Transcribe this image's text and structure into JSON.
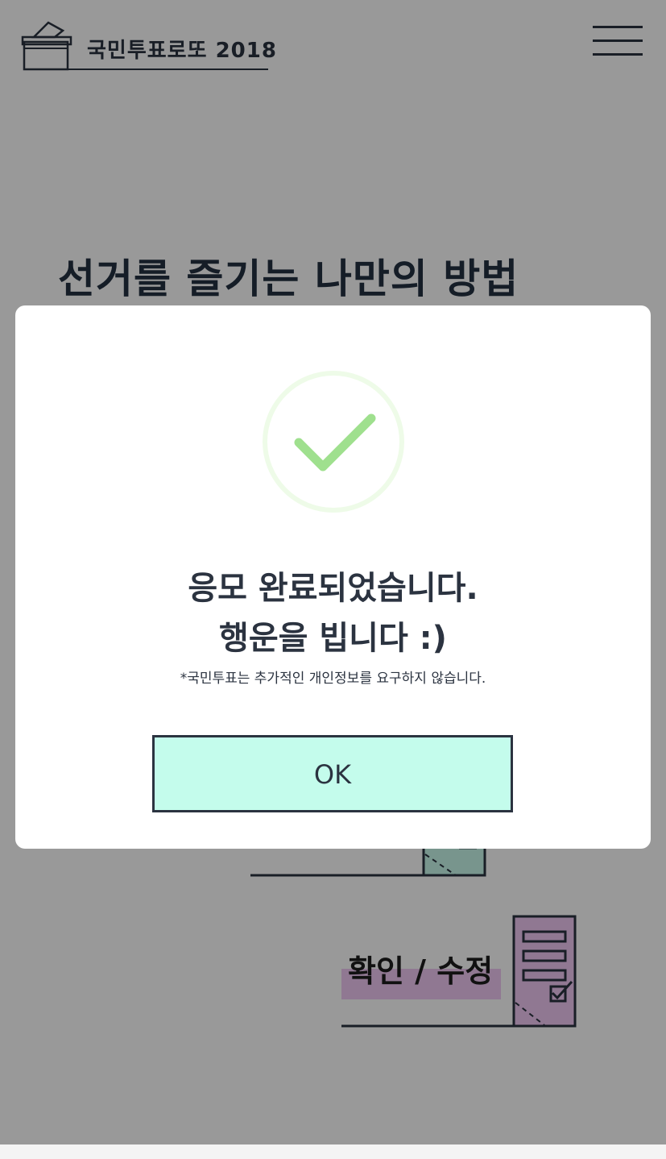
{
  "header": {
    "logo_title": "국민투표로또 2018",
    "logo_icon": "ballot-box-icon",
    "menu_icon": "hamburger-menu-icon"
  },
  "main": {
    "title": "선거를 즐기는 나만의 방법",
    "confirm_label": "확인 / 수정"
  },
  "modal": {
    "icon": "check-circle-icon",
    "line1": "응모 완료되었습니다.",
    "line2": "행운을 빕니다 :)",
    "note": "*국민투표는 추가적인 개인정보를 요구하지 않습니다.",
    "ok_label": "OK"
  },
  "colors": {
    "ink": "#2b3340",
    "ok_button_bg": "#c4fcec",
    "check_green": "#9fe08e",
    "check_ring": "#eefbe8",
    "confirm_highlight": "#f0c8f4",
    "box_teal": "#c8f8ec"
  }
}
